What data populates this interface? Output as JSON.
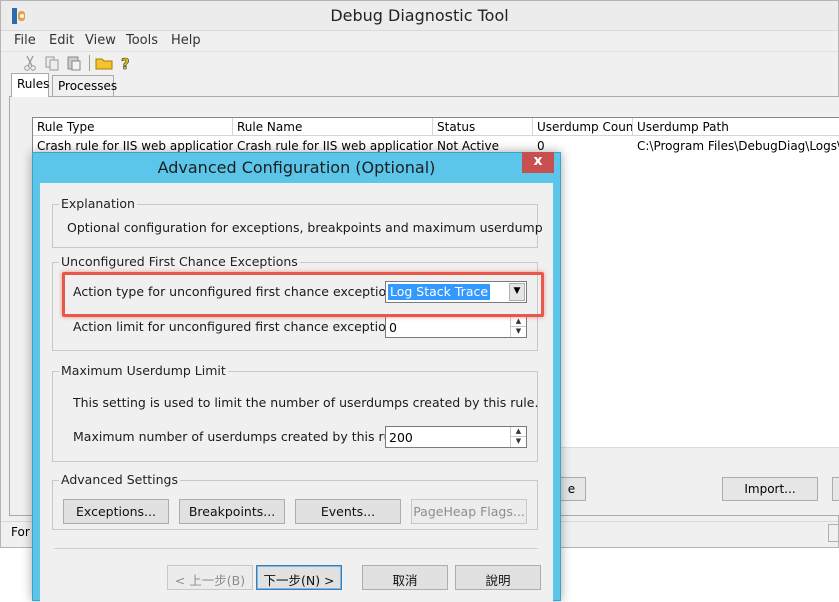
{
  "main_window": {
    "title": "Debug Diagnostic Tool",
    "menu": [
      "File",
      "Edit",
      "View",
      "Tools",
      "Help"
    ],
    "tabs": [
      "Rules",
      "Processes"
    ],
    "columns": [
      "Rule Type",
      "Rule Name",
      "Status",
      "Userdump Count",
      "Userdump Path"
    ],
    "rows": [
      {
        "rule_type": "Crash rule for IIS web application poo...",
        "rule_name": "Crash rule for IIS web application po...",
        "status": "Not Active",
        "userdump_count": "0",
        "userdump_path": "C:\\Program Files\\DebugDiag\\Logs\\Crash ru"
      }
    ],
    "partial_button": "e",
    "import_button": "Import...",
    "status_text": "For"
  },
  "dialog": {
    "title": "Advanced Configuration (Optional)",
    "close": "x",
    "explanation": {
      "title": "Explanation",
      "text": "Optional configuration for exceptions, breakpoints and maximum userdump"
    },
    "unconfigured": {
      "title": "Unconfigured First Chance Exceptions",
      "action_type_label": "Action type for unconfigured first chance exceptions:",
      "action_type_value": "Log Stack Trace",
      "action_limit_label": "Action limit for unconfigured first chance exceptions:",
      "action_limit_value": "0"
    },
    "max_userdump": {
      "title": "Maximum Userdump Limit",
      "description": "This setting is used to limit the number of userdumps created by this rule.",
      "max_label": "Maximum number of userdumps created by this rule:",
      "max_value": "200"
    },
    "advanced": {
      "title": "Advanced Settings",
      "exceptions": "Exceptions...",
      "breakpoints": "Breakpoints...",
      "events": "Events...",
      "pageheap": "PageHeap Flags..."
    },
    "nav": {
      "back": "< 上一步(B)",
      "next": "下一步(N) >",
      "cancel": "取消",
      "help": "說明"
    }
  },
  "colors": {
    "dialog_frame": "#5bc6ea",
    "highlight": "#e8584a",
    "selection": "#3399ff",
    "close_button": "#c74f4f"
  }
}
